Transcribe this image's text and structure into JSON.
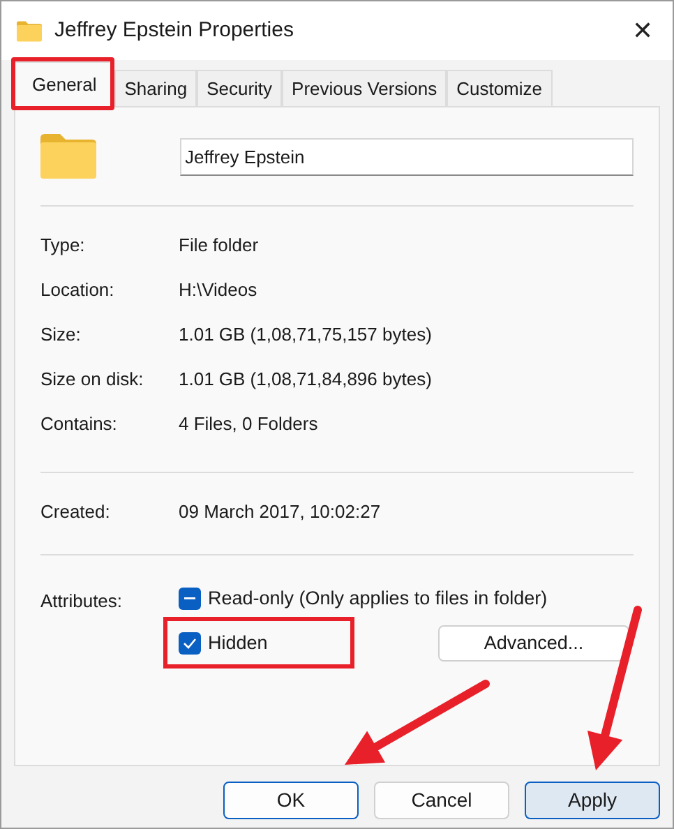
{
  "window": {
    "title": "Jeffrey Epstein Properties",
    "close": "✕"
  },
  "tabs": [
    {
      "label": "General",
      "selected": true,
      "highlighted": true
    },
    {
      "label": "Sharing",
      "selected": false,
      "highlighted": false
    },
    {
      "label": "Security",
      "selected": false,
      "highlighted": false
    },
    {
      "label": "Previous Versions",
      "selected": false,
      "highlighted": false
    },
    {
      "label": "Customize",
      "selected": false,
      "highlighted": false
    }
  ],
  "name_field": {
    "value": "Jeffrey Epstein"
  },
  "info_groups": [
    [
      {
        "label": "Type:",
        "value": "File folder"
      },
      {
        "label": "Location:",
        "value": "H:\\Videos"
      },
      {
        "label": "Size:",
        "value": "1.01 GB (1,08,71,75,157 bytes)"
      },
      {
        "label": "Size on disk:",
        "value": "1.01 GB (1,08,71,84,896 bytes)"
      },
      {
        "label": "Contains:",
        "value": "4 Files, 0 Folders"
      }
    ],
    [
      {
        "label": "Created:",
        "value": "09 March 2017, 10:02:27"
      }
    ]
  ],
  "attributes": {
    "label": "Attributes:",
    "checkboxes": [
      {
        "label": "Read-only (Only applies to files in folder)",
        "checked": false,
        "indeterminate": true,
        "highlighted": false
      },
      {
        "label": "Hidden",
        "checked": true,
        "indeterminate": false,
        "highlighted": true
      }
    ],
    "advanced_button": "Advanced..."
  },
  "buttons": [
    {
      "label": "OK",
      "default": true,
      "arrow": true
    },
    {
      "label": "Cancel",
      "default": false,
      "arrow": false
    },
    {
      "label": "Apply",
      "default": false,
      "arrow": true
    }
  ]
}
